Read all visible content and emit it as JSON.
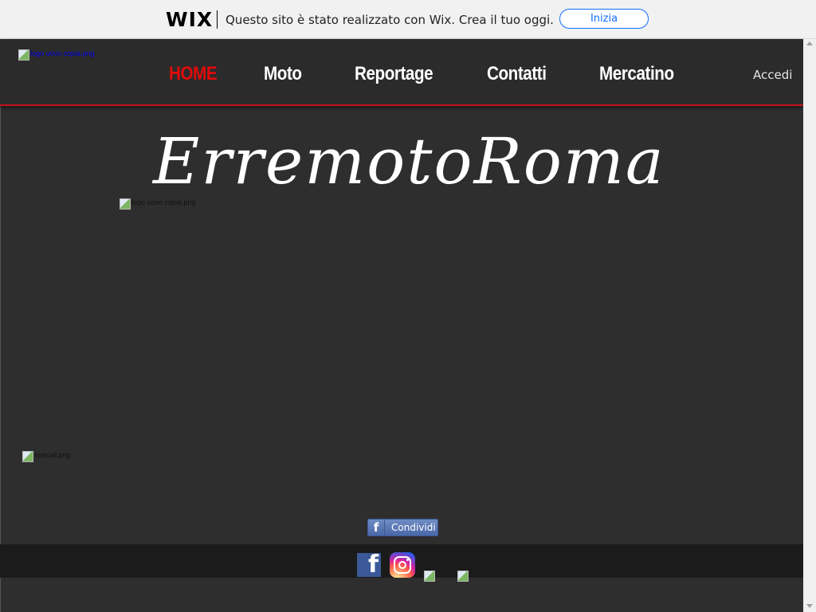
{
  "wix_banner": {
    "logo": "WIX",
    "message": "Questo sito è stato realizzato con Wix. Crea il tuo oggi.",
    "cta": "Inizia",
    "accent": "#116dff"
  },
  "header": {
    "logo_alt": "logo uovo copia.png",
    "nav": [
      "HOME",
      "Moto",
      "Reportage",
      "Contatti",
      "Mercatino"
    ],
    "active_color": "#e10b0b",
    "login": "Accedi"
  },
  "main": {
    "title": "ErremotoRoma",
    "logo_alt": "logo uovo copia.png",
    "special_alt": "special.png",
    "share_label": "Condividi"
  },
  "footer": {
    "social_icons": [
      "facebook-icon",
      "instagram-icon",
      "social-link-icon",
      "social-link-icon"
    ]
  },
  "colors": {
    "background": "#2e2e2e",
    "header_border": "#c4141b",
    "facebook": "#3b5998"
  }
}
